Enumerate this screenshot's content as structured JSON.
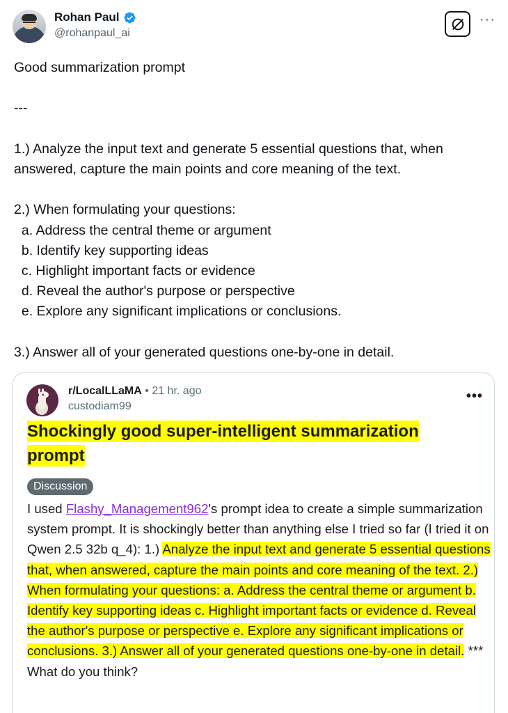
{
  "tweet": {
    "author": {
      "display_name": "Rohan Paul",
      "handle": "@rohanpaul_ai",
      "verified": true,
      "verified_color": "#1d9bf0"
    },
    "actions": {
      "grok_icon": "grok-slash-icon",
      "more_icon": "more-horizontal-icon"
    },
    "text": "Good summarization prompt\n\n---\n\n1.) Analyze the input text and generate 5 essential questions that, when answered, capture the main points and core meaning of the text.\n\n2.) When formulating your questions:\n  a. Address the central theme or argument\n  b. Identify key supporting ideas\n  c. Highlight important facts or evidence\n  d. Reveal the author's purpose or perspective\n  e. Explore any significant implications or conclusions.\n\n3.) Answer all of your generated questions one-by-one in detail."
  },
  "quoted_post": {
    "subreddit": "r/LocalLLaMA",
    "separator": "•",
    "time": "21 hr. ago",
    "username": "custodiam99",
    "title": "Shockingly good super-intelligent summarization prompt",
    "flair": "Discussion",
    "highlight_color": "#ffff00",
    "body": {
      "intro": "I used ",
      "link_text": "Flashy_Management962",
      "after_link": "'s prompt idea to create a simple summarization system prompt. It is shockingly better than anything else I tried so far (I tried it on Qwen 2.5 32b q_4): 1.) ",
      "highlighted": "Analyze the input text and generate 5 essential questions that, when answered, capture the main points and core meaning of the text. 2.) When formulating your questions: a. Address the central theme or argument b. Identify key supporting ideas c. Highlight important facts or evidence d. Reveal the author's purpose or perspective e. Explore any significant implications or conclusions. 3.) Answer all of your generated questions one-by-one in detail.",
      "outro": " *** What do you think?"
    }
  }
}
